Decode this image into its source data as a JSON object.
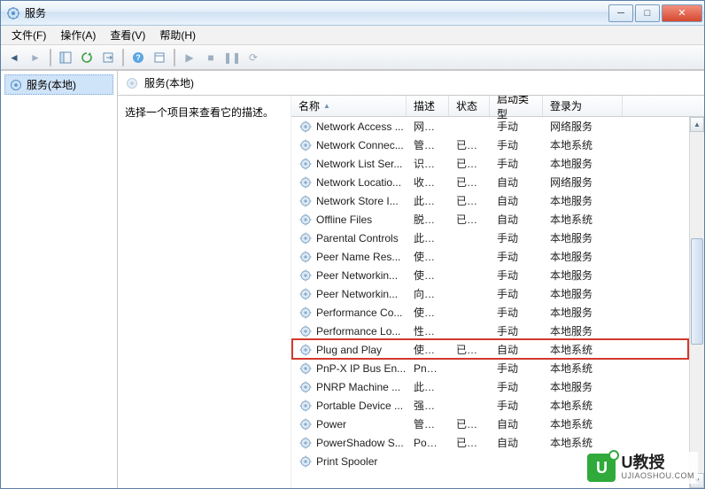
{
  "window": {
    "title": "服务"
  },
  "menu": {
    "file": "文件(F)",
    "action": "操作(A)",
    "view": "查看(V)",
    "help": "帮助(H)"
  },
  "tree": {
    "node": "服务(本地)"
  },
  "panel": {
    "heading": "服务(本地)",
    "hint": "选择一个项目来查看它的描述。"
  },
  "columns": {
    "name": "名称",
    "desc": "描述",
    "status": "状态",
    "start": "启动类型",
    "logon": "登录为"
  },
  "services": [
    {
      "name": "Network Access ...",
      "desc": "网络...",
      "status": "",
      "start": "手动",
      "logon": "网络服务"
    },
    {
      "name": "Network Connec...",
      "desc": "管理...",
      "status": "已启动",
      "start": "手动",
      "logon": "本地系统"
    },
    {
      "name": "Network List Ser...",
      "desc": "识别...",
      "status": "已启动",
      "start": "手动",
      "logon": "本地服务"
    },
    {
      "name": "Network Locatio...",
      "desc": "收集...",
      "status": "已启动",
      "start": "自动",
      "logon": "网络服务"
    },
    {
      "name": "Network Store I...",
      "desc": "此服...",
      "status": "已启动",
      "start": "自动",
      "logon": "本地服务"
    },
    {
      "name": "Offline Files",
      "desc": "脱机...",
      "status": "已启动",
      "start": "自动",
      "logon": "本地系统"
    },
    {
      "name": "Parental Controls",
      "desc": "此服...",
      "status": "",
      "start": "手动",
      "logon": "本地服务"
    },
    {
      "name": "Peer Name Res...",
      "desc": "使用...",
      "status": "",
      "start": "手动",
      "logon": "本地服务"
    },
    {
      "name": "Peer Networkin...",
      "desc": "使用...",
      "status": "",
      "start": "手动",
      "logon": "本地服务"
    },
    {
      "name": "Peer Networkin...",
      "desc": "向对...",
      "status": "",
      "start": "手动",
      "logon": "本地服务"
    },
    {
      "name": "Performance Co...",
      "desc": "使远...",
      "status": "",
      "start": "手动",
      "logon": "本地服务"
    },
    {
      "name": "Performance Lo...",
      "desc": "性能...",
      "status": "",
      "start": "手动",
      "logon": "本地服务"
    },
    {
      "name": "Plug and Play",
      "desc": "使计...",
      "status": "已启动",
      "start": "自动",
      "logon": "本地系统"
    },
    {
      "name": "PnP-X IP Bus En...",
      "desc": "PnP-...",
      "status": "",
      "start": "手动",
      "logon": "本地系统"
    },
    {
      "name": "PNRP Machine ...",
      "desc": "此服...",
      "status": "",
      "start": "手动",
      "logon": "本地服务"
    },
    {
      "name": "Portable Device ...",
      "desc": "强制...",
      "status": "",
      "start": "手动",
      "logon": "本地系统"
    },
    {
      "name": "Power",
      "desc": "管理...",
      "status": "已启动",
      "start": "自动",
      "logon": "本地系统"
    },
    {
      "name": "PowerShadow S...",
      "desc": "Pow...",
      "status": "已启动",
      "start": "自动",
      "logon": "本地系统"
    },
    {
      "name": "Print Spooler",
      "desc": "",
      "status": "",
      "start": "",
      "logon": ""
    }
  ],
  "highlightIndex": 12,
  "watermark": {
    "brand": "U教授",
    "url": "UJIAOSHOU.COM"
  }
}
